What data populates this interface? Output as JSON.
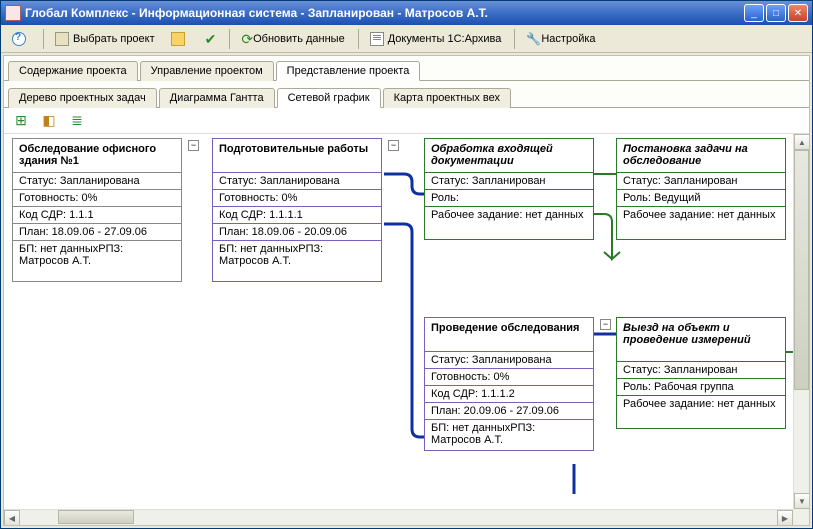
{
  "title": "Глобал Комплекс - Информационная система - Запланирован - Матросов А.Т.",
  "toolbar": {
    "help": "",
    "select_project": "Выбрать проект",
    "refresh": "Обновить данные",
    "docs": "Документы 1С:Архива",
    "settings": "Настройка"
  },
  "tabs_main": [
    {
      "id": "content",
      "label": "Содержание проекта"
    },
    {
      "id": "manage",
      "label": "Управление проектом"
    },
    {
      "id": "view",
      "label": "Представление проекта"
    }
  ],
  "tabs_main_active": "view",
  "tabs_sub": [
    {
      "id": "tree",
      "label": "Дерево проектных задач"
    },
    {
      "id": "gantt",
      "label": "Диаграмма Гантта"
    },
    {
      "id": "net",
      "label": "Сетевой график"
    },
    {
      "id": "miles",
      "label": "Карта проектных вех"
    }
  ],
  "tabs_sub_active": "net",
  "nodes": {
    "n1": {
      "title": "Обследование офисного здания №1",
      "status": "Статус: Запланирована",
      "ready": "Готовность: 0%",
      "code": "Код СДР: 1.1.1",
      "plan": "План: 18.09.06 - 27.09.06",
      "bp": "БП: нет данныхРПЗ: Матросов А.Т."
    },
    "n2": {
      "title": "Подготовительные работы",
      "status": "Статус: Запланирована",
      "ready": "Готовность: 0%",
      "code": "Код СДР: 1.1.1.1",
      "plan": "План: 18.09.06 - 20.09.06",
      "bp": "БП: нет данныхРПЗ: Матросов А.Т."
    },
    "n3": {
      "title": "Обработка входящей документации",
      "status": "Статус: Запланирован",
      "role": "Роль:",
      "task": "Рабочее задание: нет данных"
    },
    "n4": {
      "title": "Постановка задачи на обследование",
      "status": "Статус: Запланирован",
      "role": "Роль: Ведущий",
      "task": "Рабочее задание: нет данных"
    },
    "n5": {
      "title": "Проведение обследования",
      "status": "Статус: Запланирована",
      "ready": "Готовность: 0%",
      "code": "Код СДР: 1.1.1.2",
      "plan": "План: 20.09.06 - 27.09.06",
      "bp": "БП: нет данныхРПЗ: Матросов А.Т."
    },
    "n6": {
      "title": "Выезд на объект и проведение измерений",
      "status": "Статус: Запланирован",
      "role": "Роль: Рабочая группа",
      "task": "Рабочее задание: нет данных"
    }
  },
  "toggle_symbol": "⊟"
}
